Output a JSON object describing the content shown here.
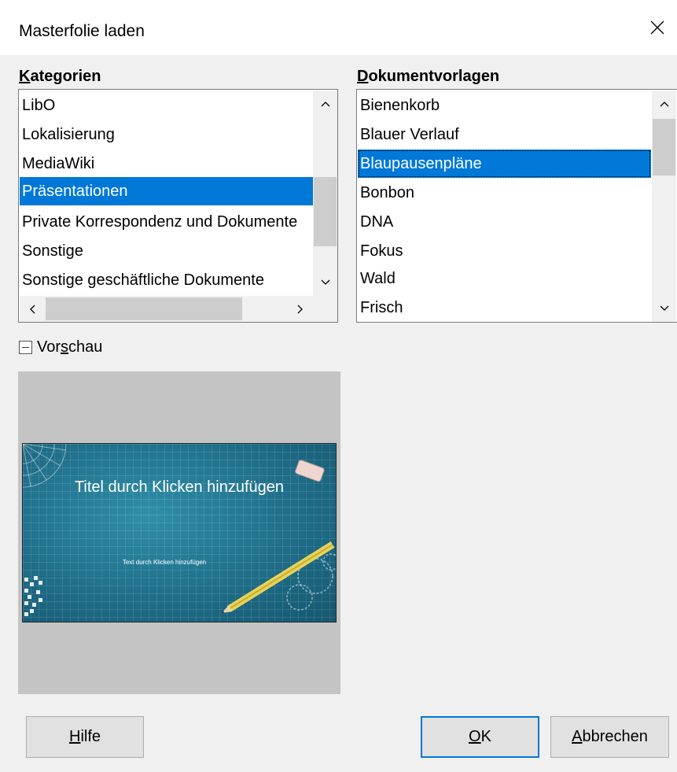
{
  "window": {
    "title": "Masterfolie laden",
    "close_icon": "close-icon"
  },
  "categories": {
    "label_accel": "K",
    "label_rest": "ategorien",
    "items": [
      "LibO",
      "Lokalisierung",
      "MediaWiki",
      "Präsentationen",
      "Private Korrespondenz und Dokumente",
      "Sonstige",
      "Sonstige geschäftliche Dokumente"
    ],
    "selected_index": 3
  },
  "templates": {
    "label_accel": "D",
    "label_rest": "okumentvorlagen",
    "items": [
      "Bienenkorb",
      "Blauer Verlauf",
      "Blaupausenpläne",
      "Bonbon",
      "DNA",
      "Fokus",
      "Wald",
      "Frisch"
    ],
    "selected_index": 2
  },
  "preview": {
    "label_before": "Vor",
    "label_accel": "s",
    "label_after": "chau",
    "expanded": true,
    "slide_title": "Titel durch Klicken hinzufügen",
    "slide_text": "Text durch Klicken hinzufügen"
  },
  "buttons": {
    "help_accel": "H",
    "help_rest": "ilfe",
    "ok_accel": "O",
    "ok_rest": "K",
    "cancel_accel": "A",
    "cancel_rest": "bbrechen"
  },
  "colors": {
    "selection": "#0078d7",
    "dialog_bg": "#f0f0f0",
    "preview_bg": "#c4c4c4"
  }
}
